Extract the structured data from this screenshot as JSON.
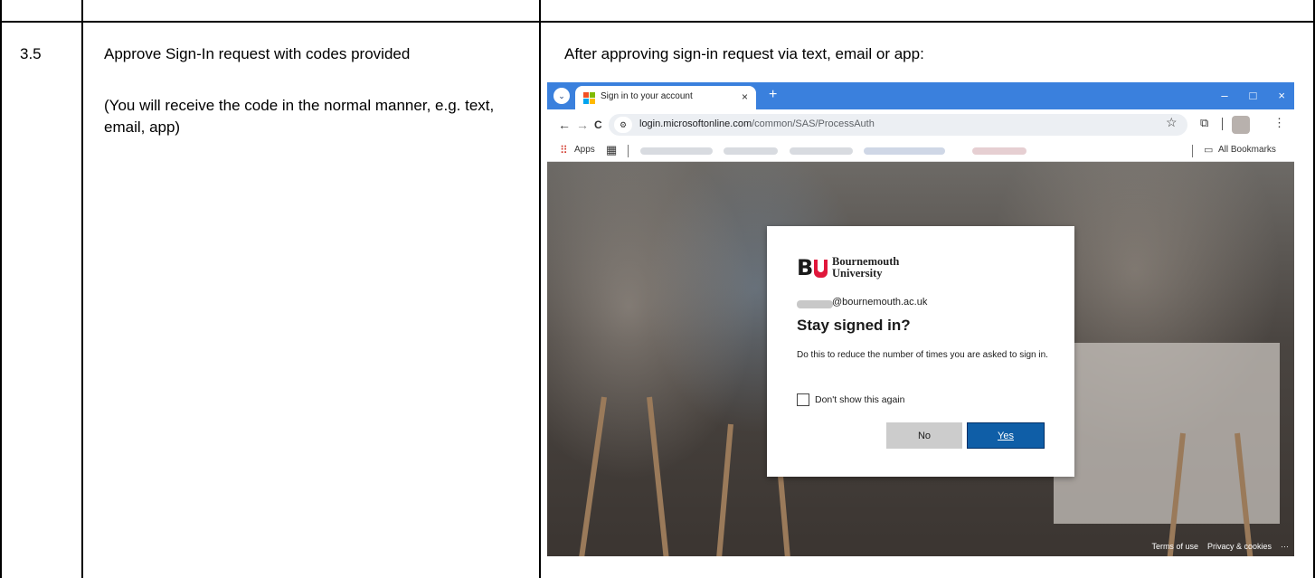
{
  "step": {
    "number": "3.5",
    "title": "Approve Sign-In request with codes provided",
    "note": "(You will receive the code in the normal manner, e.g. text, email, app)",
    "result": "After approving sign-in request via text, email or app:"
  },
  "browser": {
    "tab_title": "Sign in to your account",
    "tab_close": "×",
    "new_tab": "+",
    "window_controls": [
      "–",
      "□",
      "×"
    ],
    "url_host": "login.microsoftonline.com",
    "url_path": "/common/SAS/ProcessAuth",
    "bookmarks": {
      "apps_label": "Apps",
      "all_bookmarks_label": "All Bookmarks"
    },
    "icons": {
      "back": "←",
      "forward": "→",
      "reload": "C",
      "star": "☆",
      "extensions": "⧉",
      "menu": "⋮",
      "folder": "▭",
      "apps": "⠿",
      "grid": "▦",
      "site_info": "⚙",
      "tab_switch": "⌄"
    },
    "accent_color": "#3a80dd"
  },
  "dialog": {
    "org_name_line1": "Bournemouth",
    "org_name_line2": "University",
    "logo_letters": "B",
    "email": "@bournemouth.ac.uk",
    "title": "Stay signed in?",
    "description": "Do this to reduce the number of times you are asked to sign in.",
    "checkbox_label": "Don't show this again",
    "no_label": "No",
    "yes_label": "Yes",
    "accent_color": "#0f5ea7"
  },
  "footer": {
    "terms": "Terms of use",
    "privacy": "Privacy & cookies",
    "more": "···"
  }
}
